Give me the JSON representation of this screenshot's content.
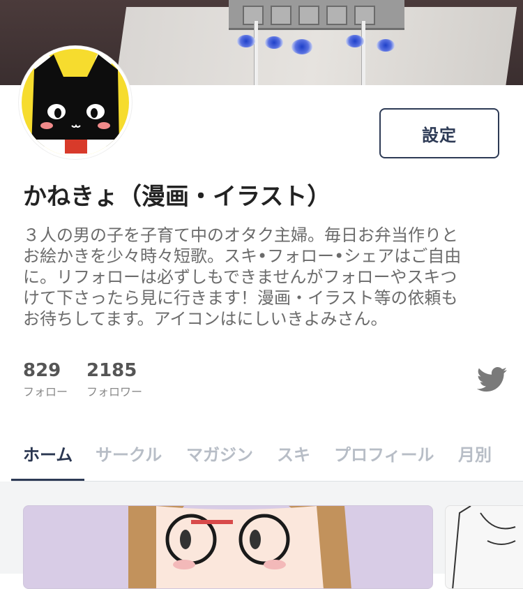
{
  "profile": {
    "name": "かねきょ（漫画・イラスト）",
    "bio_lines": [
      "３人の男の子を子育て中のオタク主婦。毎日お弁当作りと",
      "お絵かきを少々時々短歌。スキ•フォロー•シェアはご自由",
      "に。リフォローは必ずしもできませんがフォローやスキつ",
      "けて下さったら見に行きます！漫画・イラスト等の依頼も",
      "お待ちしてます。アイコンはにしいきよみさん。"
    ],
    "settings_label": "設定"
  },
  "stats": {
    "following": {
      "count": "829",
      "label": "フォロー"
    },
    "followers": {
      "count": "2185",
      "label": "フォロワー"
    }
  },
  "tabs": [
    {
      "label": "ホーム",
      "active": true
    },
    {
      "label": "サークル",
      "active": false
    },
    {
      "label": "マガジン",
      "active": false
    },
    {
      "label": "スキ",
      "active": false
    },
    {
      "label": "プロフィール",
      "active": false
    },
    {
      "label": "月別",
      "active": false
    }
  ],
  "icons": {
    "twitter": "twitter-icon",
    "avatar": "black-cat-avatar"
  },
  "colors": {
    "accent": "#2d3a55",
    "twitter": "#7a7a7a",
    "inactive_tab": "#b7bdc6"
  }
}
